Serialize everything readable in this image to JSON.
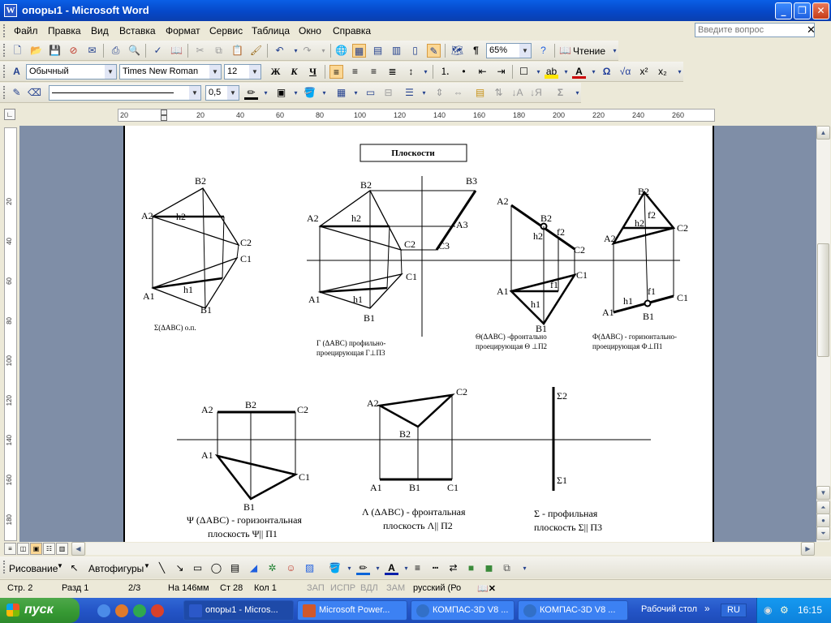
{
  "window": {
    "title": "опоры1 - Microsoft Word",
    "app_icon_letter": "W"
  },
  "menu": {
    "items": [
      "Файл",
      "Правка",
      "Вид",
      "Вставка",
      "Формат",
      "Сервис",
      "Таблица",
      "Окно",
      "Справка"
    ],
    "help_placeholder": "Введите вопрос"
  },
  "toolbar1": {
    "zoom": "65%",
    "reading": "Чтение"
  },
  "toolbar2": {
    "style": "Обычный",
    "font": "Times New Roman",
    "size": "12"
  },
  "toolbar3": {
    "line_weight": "0,5"
  },
  "ruler": {
    "h_ticks": [
      "20",
      "20",
      "40",
      "60",
      "80",
      "100",
      "120",
      "140",
      "160",
      "180",
      "200",
      "220",
      "240",
      "260"
    ],
    "v_ticks": [
      "20",
      "40",
      "60",
      "80",
      "100",
      "120",
      "140",
      "160",
      "180"
    ]
  },
  "document": {
    "heading": "Плоскости",
    "labels": {
      "A2": "A2",
      "B2": "B2",
      "C2": "C2",
      "A1": "A1",
      "B1": "B1",
      "C1": "C1",
      "B3": "B3",
      "A3": "A3",
      "C3": "C3",
      "h2": "h2",
      "h1": "h1",
      "f2": "f2",
      "f1": "f1",
      "S2": "Σ2",
      "S1": "Σ1"
    },
    "captions": {
      "c1": "Σ(ΔABC)  о.п.",
      "c2a": "Г (ΔABC)  профильно-",
      "c2b": "проецирующая   Г⊥П3",
      "c3a": "Θ(ΔABC)   -фронтально",
      "c3b": "проецирующая   Θ ⊥П2",
      "c4a": "Ф(ΔABC)  - горизонтально-",
      "c4b": "проецирующая   Ф⊥П1",
      "c5a": "Ψ    (ΔABC) -   горизонтальная",
      "c5b": "плоскость   Ψ|| П1",
      "c6a": "Λ    (ΔABC) - фронтальная",
      "c6b": "плоскость  Λ|| П2",
      "c7a": "Σ  -  профильная",
      "c7b": "плоскость   Σ|| П3"
    }
  },
  "drawbar": {
    "drawing": "Рисование",
    "autoshapes": "Автофигуры"
  },
  "status": {
    "page": "Стр.  2",
    "section": "Разд  1",
    "pages": "2/3",
    "at": "На  146мм",
    "line": "Ст  28",
    "col": "Кол  1",
    "rec": "ЗАП",
    "trk": "ИСПР",
    "ext": "ВДЛ",
    "ovr": "ЗАМ",
    "lang": "русский (Ро"
  },
  "taskbar": {
    "start": "пуск",
    "tasks": [
      "опоры1 - Micros...",
      "Microsoft Power...",
      "КОМПАС-3D V8 ...",
      "КОМПАС-3D V8 ..."
    ],
    "desktop": "Рабочий стол",
    "lang": "RU",
    "clock": "16:15"
  },
  "colors": {
    "titlebar": "#0a5fe6",
    "workspace": "#7f8ea7",
    "taskbar": "#2455c7",
    "start": "#379a34"
  }
}
